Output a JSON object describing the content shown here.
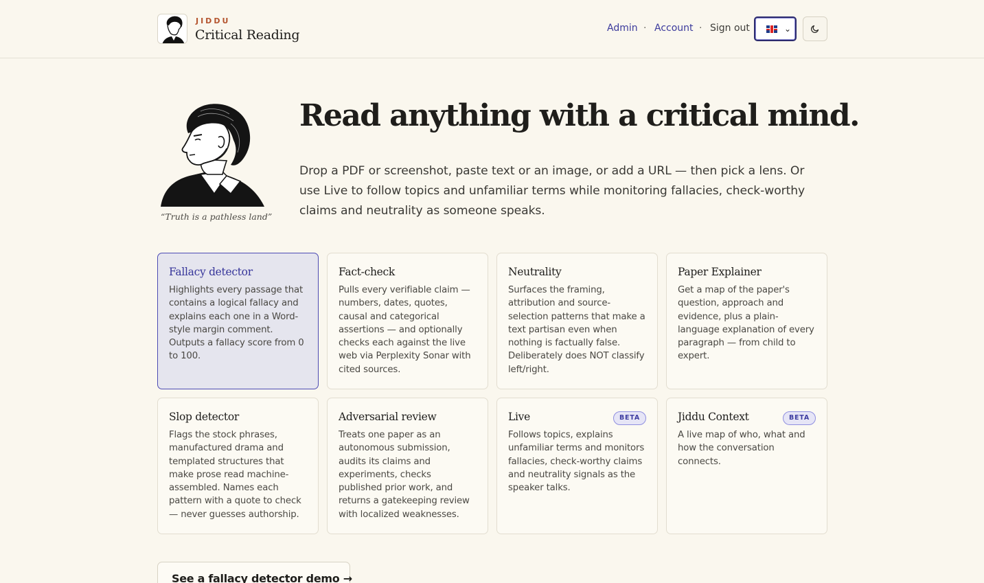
{
  "brand": {
    "kicker": "JIDDU",
    "title": "Critical Reading"
  },
  "nav": {
    "admin": "Admin",
    "account": "Account",
    "sign_out": "Sign out",
    "separator": "·",
    "language_selected": "en-GB flag",
    "theme_toggle_icon": "moon-icon"
  },
  "hero": {
    "quote": "“Truth is a pathless land”",
    "title": "Read anything with a critical mind.",
    "subtitle": "Drop a PDF or screenshot, paste text or an image, or add a URL — then pick a lens. Or use Live to follow topics and unfamiliar terms while monitoring fallacies, check-worthy claims and neutrality as someone speaks."
  },
  "lenses": [
    {
      "title": "Fallacy detector",
      "description": "Highlights every passage that contains a logical fallacy and explains each one in a Word-style margin comment. Outputs a fallacy score from 0 to 100.",
      "active": true
    },
    {
      "title": "Fact-check",
      "description": "Pulls every verifiable claim — numbers, dates, quotes, causal and categorical assertions — and optionally checks each against the live web via Perplexity Sonar with cited sources."
    },
    {
      "title": "Neutrality",
      "description": "Surfaces the framing, attribution and source-selection patterns that make a text partisan even when nothing is factually false. Deliberately does NOT classify left/right."
    },
    {
      "title": "Paper Explainer",
      "description": "Get a map of the paper's question, approach and evidence, plus a plain-language explanation of every paragraph — from child to expert."
    },
    {
      "title": "Slop detector",
      "description": "Flags the stock phrases, manufactured drama and templated structures that make prose read machine-assembled. Names each pattern with a quote to check — never guesses authorship."
    },
    {
      "title": "Adversarial review",
      "description": "Treats one paper as an autonomous submission, audits its claims and experiments, checks published prior work, and returns a gatekeeping review with localized weaknesses."
    },
    {
      "title": "Live",
      "badge": "BETA",
      "description": "Follows topics, explains unfamiliar terms and monitors fallacies, check-worthy claims and neutrality signals as the speaker talks."
    },
    {
      "title": "Jiddu Context",
      "badge": "BETA",
      "description": "A live map of who, what and how the conversation connects."
    }
  ],
  "demo_button": "See a fallacy detector demo →",
  "colors": {
    "background": "#faf7ee",
    "accent": "#3b3a9c",
    "kicker": "#b4542e",
    "active_card": "#e5e5ee"
  }
}
